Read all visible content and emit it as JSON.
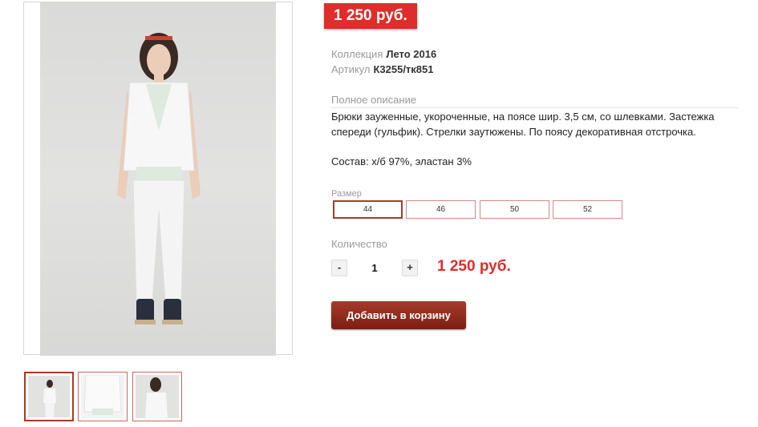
{
  "product": {
    "price_badge": "1 250 руб.",
    "collection_label": "Коллекция",
    "collection_value": "Лето 2016",
    "article_label": "Артикул",
    "article_value": "К3255/тк851",
    "description_label": "Полное описание",
    "description_text": "Брюки зауженные, укороченные, на поясе шир. 3,5 см, со шлевками. Застежка спереди (гульфик). Стрелки заутюжены. По поясу декоративная отстрочка.",
    "composition": "Состав: х/б 97%, эластан 3%"
  },
  "size": {
    "label": "Размер",
    "options": [
      "44",
      "46",
      "50",
      "52"
    ],
    "selected": "44"
  },
  "quantity": {
    "label": "Количество",
    "minus": "-",
    "value": "1",
    "plus": "+"
  },
  "total_price": "1 250 руб.",
  "add_to_cart_label": "Добавить в корзину",
  "colors": {
    "accent_red": "#de2d2a",
    "button_dark_red": "#7c1e14",
    "selected_border": "#a83a2c"
  }
}
